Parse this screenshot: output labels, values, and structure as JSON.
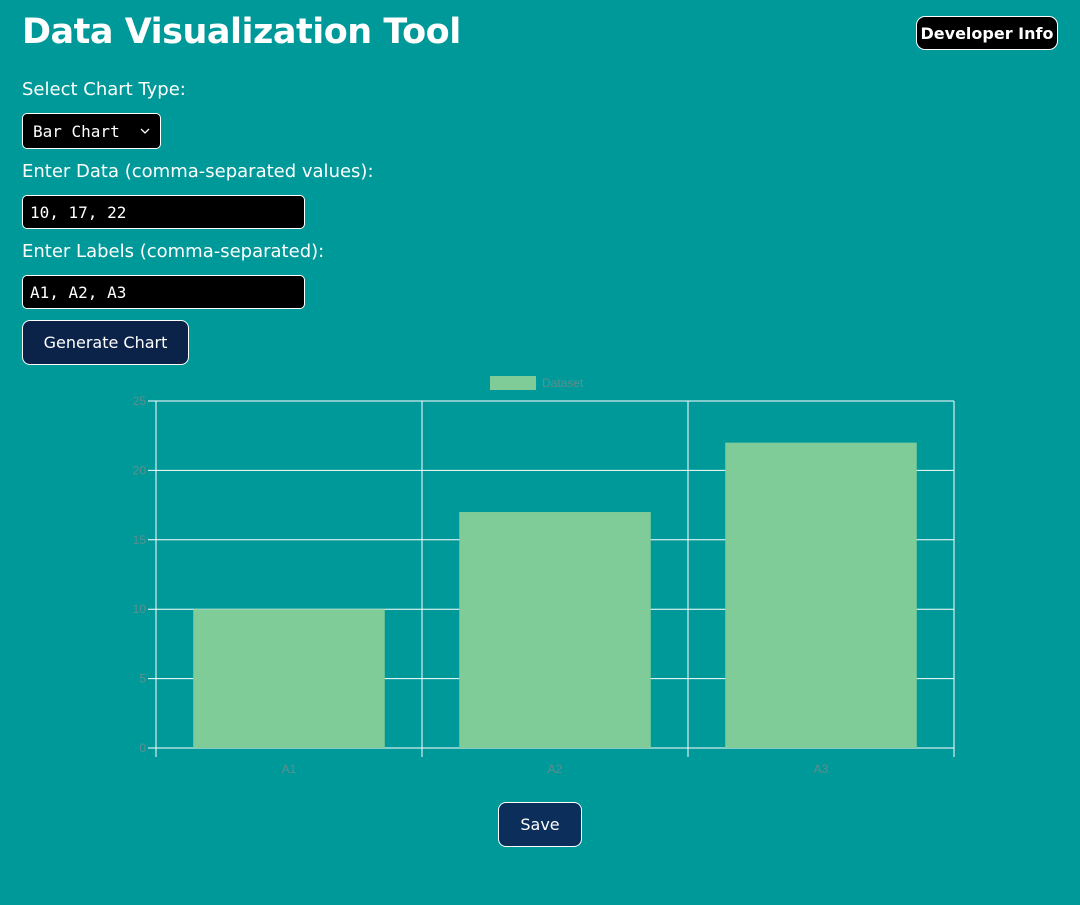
{
  "header": {
    "title": "Data Visualization Tool",
    "developer_button": "Developer Info"
  },
  "form": {
    "chart_type_label": "Select Chart Type:",
    "chart_type_value": "Bar Chart",
    "data_label": "Enter Data (comma-separated values):",
    "data_value": "10, 17, 22",
    "labels_label": "Enter Labels (comma-separated):",
    "labels_value": "A1, A2, A3",
    "generate_button": "Generate Chart"
  },
  "chart_data": {
    "type": "bar",
    "categories": [
      "A1",
      "A2",
      "A3"
    ],
    "series": [
      {
        "name": "Dataset",
        "values": [
          10,
          17,
          22
        ]
      }
    ],
    "y_ticks": [
      "0",
      "5",
      "10",
      "15",
      "20",
      "25"
    ],
    "ylim": [
      0,
      25
    ],
    "legend": "top-center",
    "grid": true,
    "bar_color": "#80cc99",
    "grid_color": "#ffffff",
    "tick_color": "#5d8f8f"
  },
  "actions": {
    "save_button": "Save"
  },
  "colors": {
    "background": "#009999",
    "input_background": "#000000",
    "primary_button": "#0b2348"
  }
}
